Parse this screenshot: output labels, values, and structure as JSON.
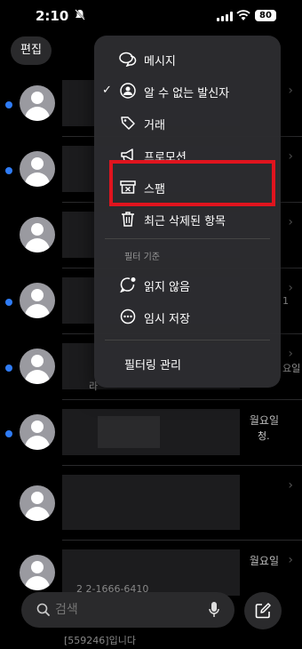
{
  "status_bar": {
    "time": "2:10",
    "battery": "80"
  },
  "header": {
    "edit_label": "편집"
  },
  "menu": {
    "items": [
      {
        "label": "메시지",
        "icon": "chat-bubbles-icon",
        "checked": false
      },
      {
        "label": "알 수 없는 발신자",
        "icon": "person-question-icon",
        "checked": true
      },
      {
        "label": "거래",
        "icon": "tag-icon",
        "checked": false
      },
      {
        "label": "프로모션",
        "icon": "megaphone-icon",
        "checked": false
      },
      {
        "label": "스팸",
        "icon": "spam-box-icon",
        "checked": false
      },
      {
        "label": "최근 삭제된 항목",
        "icon": "trash-icon",
        "checked": false
      }
    ],
    "filter_section": "필터 기준",
    "filter_items": [
      {
        "label": "읽지 않음",
        "icon": "unread-bubble-icon"
      },
      {
        "label": "임시 저장",
        "icon": "draft-bubble-icon"
      }
    ],
    "manage_label": "필터링 관리"
  },
  "highlight_color": "#e0141e",
  "accent_color": "#2f7cf6",
  "list": {
    "fragments": [
      "월요일",
      "청.",
      "월요일",
      "요일",
      "1",
      "라"
    ],
    "rows": [
      {
        "unread": true
      },
      {
        "unread": true
      },
      {
        "unread": false
      },
      {
        "unread": true
      },
      {
        "unread": true
      },
      {
        "unread": true
      },
      {
        "unread": false
      },
      {
        "unread": false
      }
    ]
  },
  "search": {
    "placeholder": "검색"
  },
  "background_fragments": [
    "2 2-1666-6410",
    "[559246]입니다"
  ]
}
